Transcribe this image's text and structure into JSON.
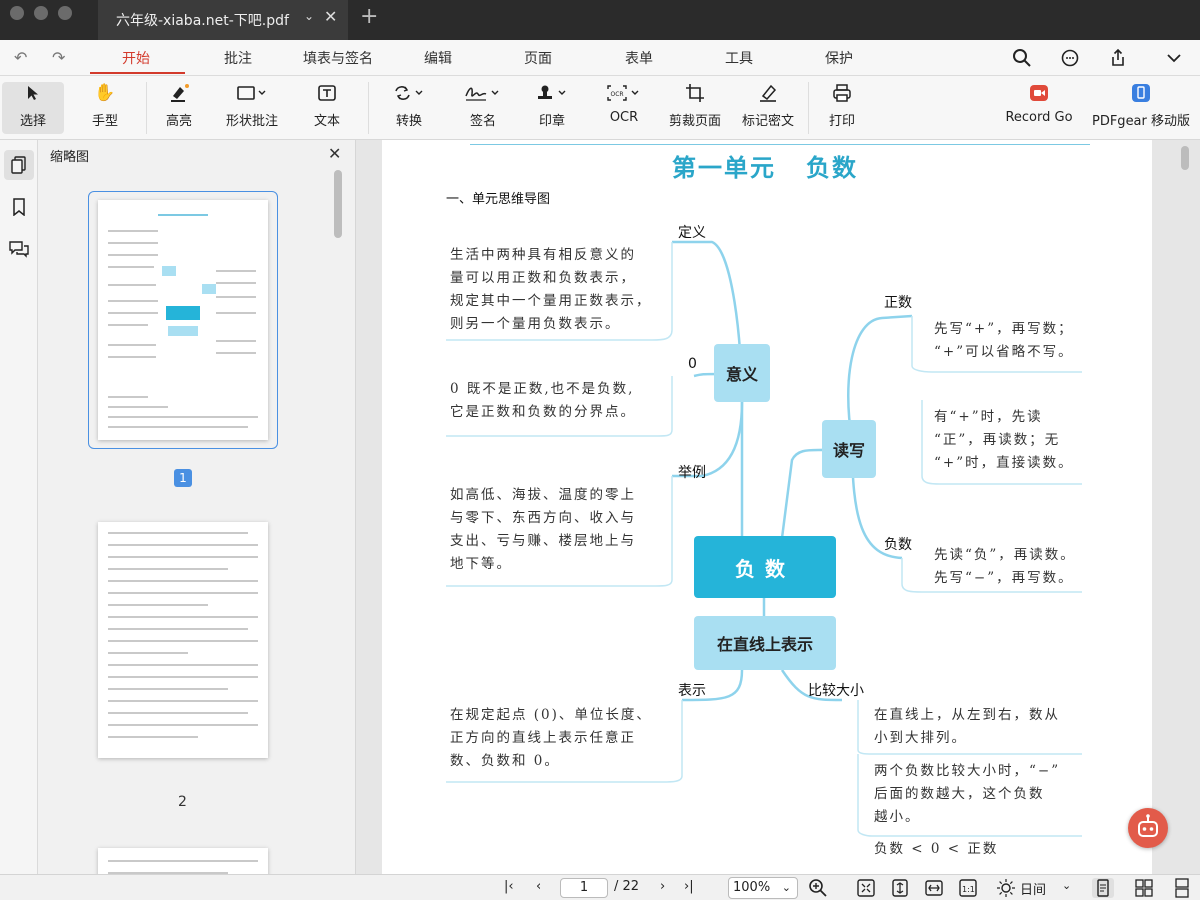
{
  "window": {
    "tab_title": "六年级-xiaba.net-下吧.pdf"
  },
  "menu": {
    "tabs": [
      "开始",
      "批注",
      "填表与签名",
      "编辑",
      "页面",
      "表单",
      "工具",
      "保护"
    ],
    "active": "开始"
  },
  "toolbar": {
    "select": "选择",
    "hand": "手型",
    "highlight": "高亮",
    "shape": "形状批注",
    "text": "文本",
    "convert": "转换",
    "sign": "签名",
    "stamp": "印章",
    "ocr": "OCR",
    "crop": "剪裁页面",
    "redact": "标记密文",
    "print": "打印",
    "record": "Record Go",
    "mobile": "PDFgear 移动版"
  },
  "sidebar": {
    "title": "缩略图",
    "pages": [
      "1",
      "2"
    ]
  },
  "document": {
    "title_part1": "第一单元",
    "title_part2": "负数",
    "section": "一、单元思维导图",
    "nodes": {
      "meaning": "意义",
      "read_write": "读写",
      "center": "负数",
      "on_line": "在直线上表示"
    },
    "labels": {
      "definition": "定义",
      "zero": "0",
      "example": "举例",
      "positive": "正数",
      "negative": "负数",
      "represent": "表示",
      "compare": "比较大小"
    },
    "texts": {
      "definition_1": "生活中两种具有相反意义的",
      "definition_2": "量可以用正数和负数表示，",
      "definition_3": "规定其中一个量用正数表示，",
      "definition_4": "则另一个量用负数表示。",
      "zero_1": "0 既不是正数,也不是负数,",
      "zero_2": "它是正数和负数的分界点。",
      "example_1": "如高低、海拔、温度的零上",
      "example_2": "与零下、东西方向、收入与",
      "example_3": "支出、亏与赚、楼层地上与",
      "example_4": "地下等。",
      "positive_1": "先写“+”，再写数；",
      "positive_2": "“+”可以省略不写。",
      "plus_1": "有“+”时，先读",
      "plus_2": "“正”，再读数；无",
      "plus_3": "“+”时，直接读数。",
      "negative_1": "先读“负”，再读数。",
      "negative_2": "先写“−”，再写数。",
      "represent_1": "在规定起点 (0)、单位长度、",
      "represent_2": "正方向的直线上表示任意正",
      "represent_3": "数、负数和 0。",
      "compare_1": "在直线上，从左到右，数从",
      "compare_2": "小到大排列。",
      "compare_3": "两个负数比较大小时，“−”",
      "compare_4": "后面的数越大，这个负数",
      "compare_5": "越小。",
      "compare_6": "负数 < 0 < 正数"
    }
  },
  "status": {
    "current_page": "1",
    "total_pages": "/ 22",
    "zoom": "100%",
    "theme": "日间"
  },
  "colors": {
    "accent": "#d33a2c",
    "mindmap_center": "#25b4d9",
    "mindmap_node": "#a9dff2",
    "title": "#2aa6c9",
    "selection": "#4a90e2"
  }
}
